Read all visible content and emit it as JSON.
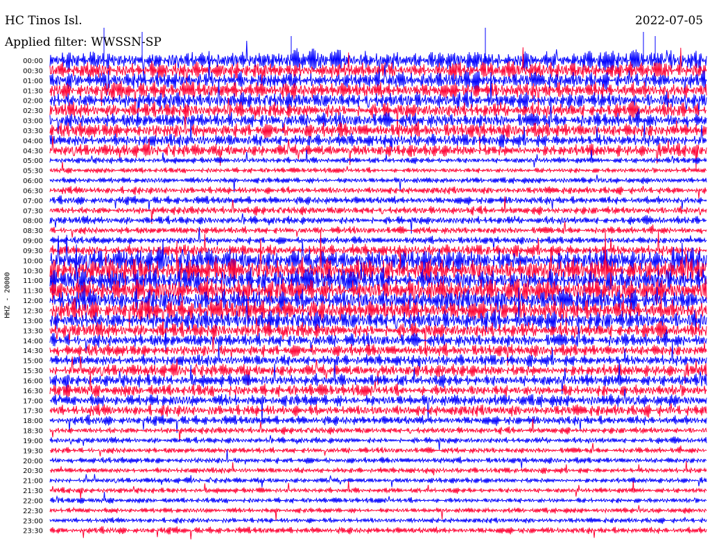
{
  "header": {
    "station": "HC Tinos Isl.",
    "date": "2022-07-05",
    "filter": "Applied filter: WWSSN-SP"
  },
  "colors": {
    "trace_a": "#0000ff",
    "trace_b": "#ff0033",
    "background": "#ffffff"
  },
  "chart_data": {
    "type": "line",
    "title": "HC Tinos Isl.",
    "ylabel": "HHZ - 20000",
    "ytick_labels": [
      "00:00",
      "00:30",
      "01:00",
      "01:30",
      "02:00",
      "02:30",
      "03:00",
      "03:30",
      "04:00",
      "04:30",
      "05:00",
      "05:30",
      "06:00",
      "06:30",
      "07:00",
      "07:30",
      "08:00",
      "08:30",
      "09:00",
      "09:30",
      "10:00",
      "10:30",
      "11:00",
      "11:30",
      "12:00",
      "12:30",
      "13:00",
      "13:30",
      "14:00",
      "14:30",
      "15:00",
      "15:30",
      "16:00",
      "16:30",
      "17:00",
      "17:30",
      "18:00",
      "18:30",
      "19:00",
      "19:30",
      "20:00",
      "20:30",
      "21:00",
      "21:30",
      "22:00",
      "22:30",
      "23:00",
      "23:30"
    ],
    "series": [
      {
        "values": [
          0.55,
          0.55,
          0.55,
          0.55,
          0.5,
          0.5,
          0.5,
          0.5,
          0.45,
          0.45
        ]
      },
      {
        "values": [
          0.55,
          0.55,
          0.55,
          0.5,
          0.5,
          0.5,
          0.5,
          0.5,
          0.45,
          0.45
        ]
      }
    ],
    "amplitude_by_row": [
      1.4,
      1.2,
      1.2,
      1.2,
      1.2,
      1.1,
      1.1,
      1.1,
      1.0,
      0.9,
      0.45,
      0.4,
      0.45,
      0.55,
      0.6,
      0.6,
      0.6,
      0.55,
      0.55,
      0.9,
      1.6,
      1.7,
      1.7,
      1.7,
      1.6,
      1.5,
      1.4,
      1.1,
      1.0,
      0.9,
      0.9,
      0.9,
      0.9,
      0.9,
      0.9,
      0.85,
      0.7,
      0.5,
      0.45,
      0.45,
      0.45,
      0.45,
      0.4,
      0.4,
      0.4,
      0.4,
      0.4,
      0.5
    ],
    "grid": false,
    "legend": "none"
  }
}
